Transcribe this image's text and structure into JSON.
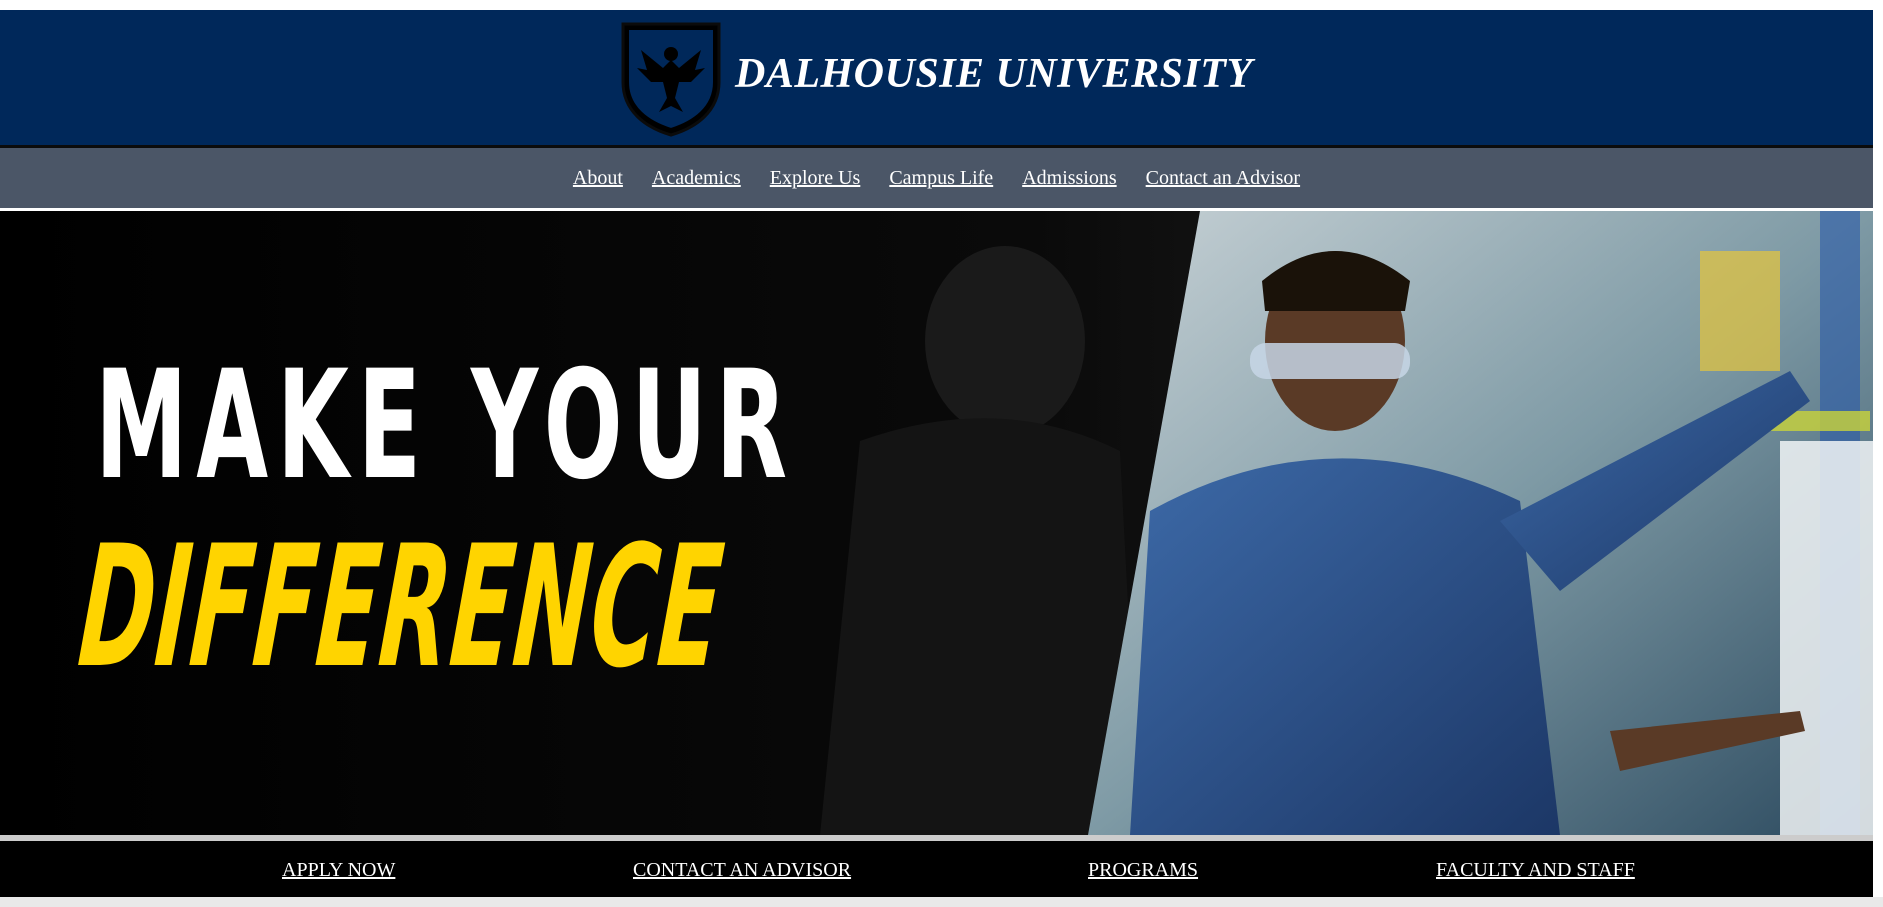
{
  "header": {
    "title": "DALHOUSIE UNIVERSITY",
    "crest_icon": "eagle-shield-icon",
    "bg_color": "#00285a"
  },
  "nav": {
    "items": [
      {
        "label": "About"
      },
      {
        "label": "Academics"
      },
      {
        "label": "Explore Us"
      },
      {
        "label": "Campus Life"
      },
      {
        "label": "Admissions"
      },
      {
        "label": "Contact an Advisor"
      }
    ],
    "bg_color": "#4b5667"
  },
  "hero": {
    "line1": "MAKE YOUR",
    "line2": "DIFFERENCE",
    "line1_color": "#ffffff",
    "line2_color": "#ffd400"
  },
  "footer": {
    "links": [
      {
        "label": "APPLY NOW"
      },
      {
        "label": "CONTACT AN ADVISOR"
      },
      {
        "label": "PROGRAMS"
      },
      {
        "label": "FACULTY AND STAFF"
      }
    ]
  }
}
